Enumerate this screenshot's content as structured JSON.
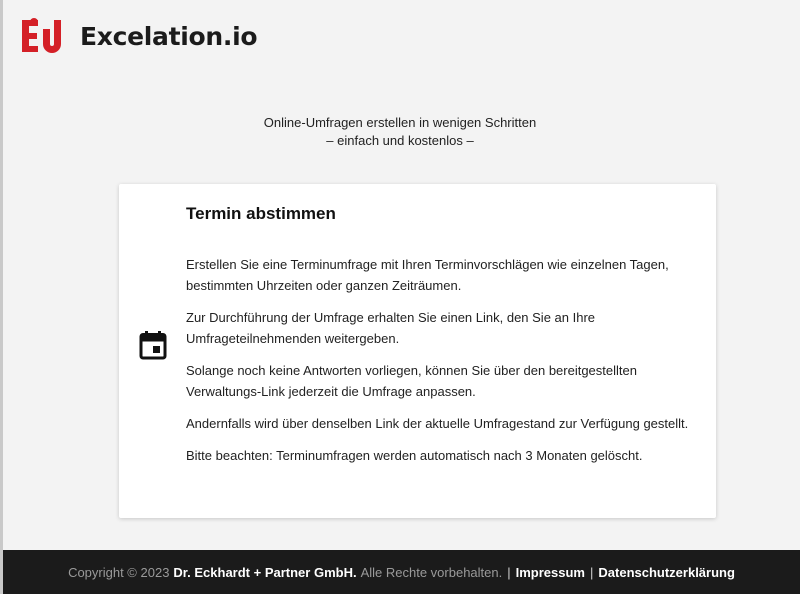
{
  "brand": {
    "name": "Excelation.io",
    "logo_letters": "EU",
    "accent_color": "#d42027"
  },
  "tagline": {
    "line1": "Online-Umfragen erstellen in wenigen Schritten",
    "line2": "– einfach und kostenlos –"
  },
  "card": {
    "icon": "calendar-icon",
    "title": "Termin abstimmen",
    "paragraphs": [
      "Erstellen Sie eine Terminumfrage mit Ihren Terminvorschlägen wie einzelnen Tagen, bestimmten Uhrzeiten oder ganzen Zeiträumen.",
      "Zur Durchführung der Umfrage erhalten Sie einen Link, den Sie an Ihre Umfrageteilnehmenden weitergeben.",
      "Solange noch keine Antworten vorliegen, können Sie über den bereitgestellten Verwaltungs-Link jederzeit die Umfrage anpassen.",
      "Andernfalls wird über denselben Link der aktuelle Umfragestand zur Verfügung gestellt.",
      "Bitte beachten: Terminumfragen werden automatisch nach 3 Monaten gelöscht."
    ]
  },
  "footer": {
    "copyright": "Copyright © 2023",
    "company": "Dr. Eckhardt + Partner GmbH.",
    "rights": "Alle Rechte vorbehalten.",
    "separator": "|",
    "impressum": "Impressum",
    "privacy": "Datenschutzerklärung"
  }
}
